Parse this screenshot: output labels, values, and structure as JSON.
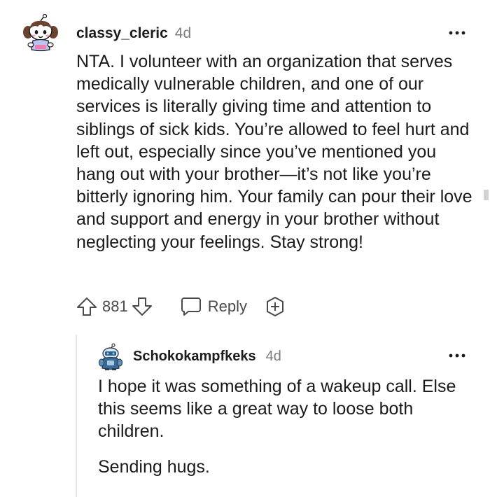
{
  "comment": {
    "username": "classy_cleric",
    "age": "4d",
    "avatar_icon": "snoo-avatar-girl-icon",
    "more_icon": "more-options-icon",
    "body": "NTA. I volunteer with an organization that serves medically vulnerable children, and one of our services is literally giving time and attention to siblings of sick kids. You’re allowed to feel hurt and left out, especially since you’ve mentioned you hang out with your brother—it’s not like you’re bitterly ignoring him. Your family can pour their love and support and energy in your brother without neglecting your feelings. Stay strong!",
    "score": "881",
    "reply_label": "Reply",
    "upvote_icon": "upvote-arrow-icon",
    "downvote_icon": "downvote-arrow-icon",
    "reply_icon": "reply-bubble-icon",
    "award_icon": "award-plus-icon"
  },
  "reply": {
    "username": "Schokokampfkeks",
    "age": "4d",
    "avatar_icon": "snoo-avatar-robot-icon",
    "more_icon": "more-options-icon",
    "paragraphs": [
      "I hope it was something of a wakeup call. Else this seems like a great way to loose both children.",
      "Sending hugs."
    ]
  },
  "colors": {
    "text": "#1a1a1b",
    "meta": "#7c7c7c",
    "icon": "#4a4a4a",
    "thread_line": "#e6e6e6"
  }
}
